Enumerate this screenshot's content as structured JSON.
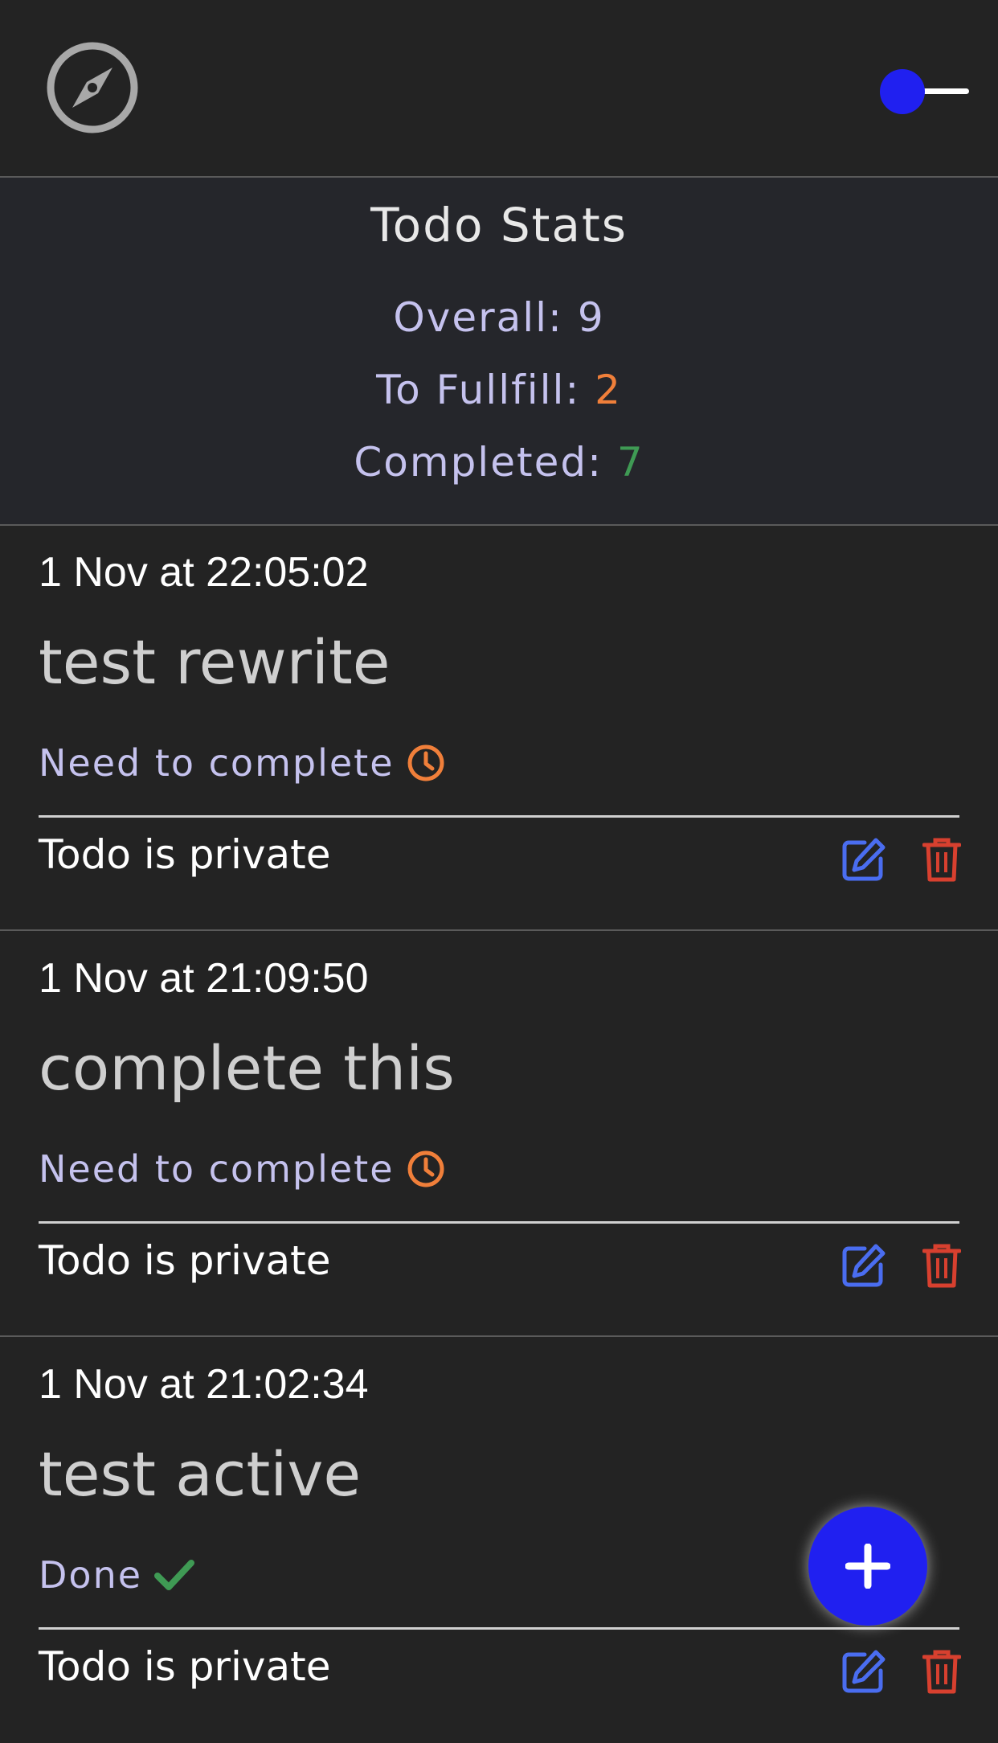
{
  "colors": {
    "accent": "#2020f0",
    "warning": "#f07f3a",
    "success": "#3f9a54",
    "edit": "#4a6df0",
    "delete": "#d8402f"
  },
  "header": {
    "logo_icon": "compass-icon",
    "theme_toggle_on": false
  },
  "stats": {
    "title": "Todo Stats",
    "overall_label": "Overall: ",
    "overall_value": "9",
    "to_fulfill_label": "To Fullfill: ",
    "to_fulfill_value": "2",
    "completed_label": "Completed: ",
    "completed_value": "7"
  },
  "todos": [
    {
      "date": "1 Nov at 22:05:02",
      "title": "test rewrite",
      "status": "Need to complete",
      "status_icon": "clock-icon",
      "privacy": "Todo is private"
    },
    {
      "date": "1 Nov at 21:09:50",
      "title": "complete this",
      "status": "Need to complete",
      "status_icon": "clock-icon",
      "privacy": "Todo is private"
    },
    {
      "date": "1 Nov at 21:02:34",
      "title": "test active",
      "status": "Done",
      "status_icon": "check-icon",
      "privacy": "Todo is private"
    }
  ],
  "fab": {
    "icon": "plus-icon"
  }
}
